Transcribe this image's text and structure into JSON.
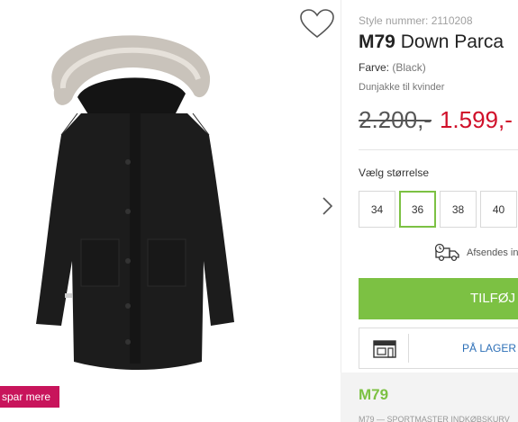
{
  "gallery": {
    "wishlist_icon": "heart-outline-icon",
    "next_icon": "chevron-right-icon",
    "save_badge": "spar mere"
  },
  "product": {
    "style_number": "Style nummer: 2110208",
    "brand": "M79",
    "name": "Down Parca",
    "color_label": "Farve:",
    "color_value": "(Black)",
    "description": "Dunjakke til kvinder",
    "old_price": "2.200,-",
    "new_price": "1.599,-"
  },
  "sizes": {
    "label": "Vælg størrelse",
    "options": [
      "34",
      "36",
      "38",
      "40"
    ],
    "selected": "36"
  },
  "shipping": {
    "icon": "delivery-truck-icon",
    "text": "Afsendes inden"
  },
  "actions": {
    "add_to_cart": "TILFØJ TIL KURV",
    "store_icon": "store-icon",
    "in_store": "PÅ LAGER I BUTIK"
  },
  "brand_section": {
    "title": "M79",
    "subtitle": "M79 — SPORTMASTER  INDKØBSKURV"
  },
  "colors": {
    "accent_green": "#7cc143",
    "sale_red": "#d0102a",
    "badge_pink": "#c8145b",
    "link_blue": "#2c6fb7"
  }
}
